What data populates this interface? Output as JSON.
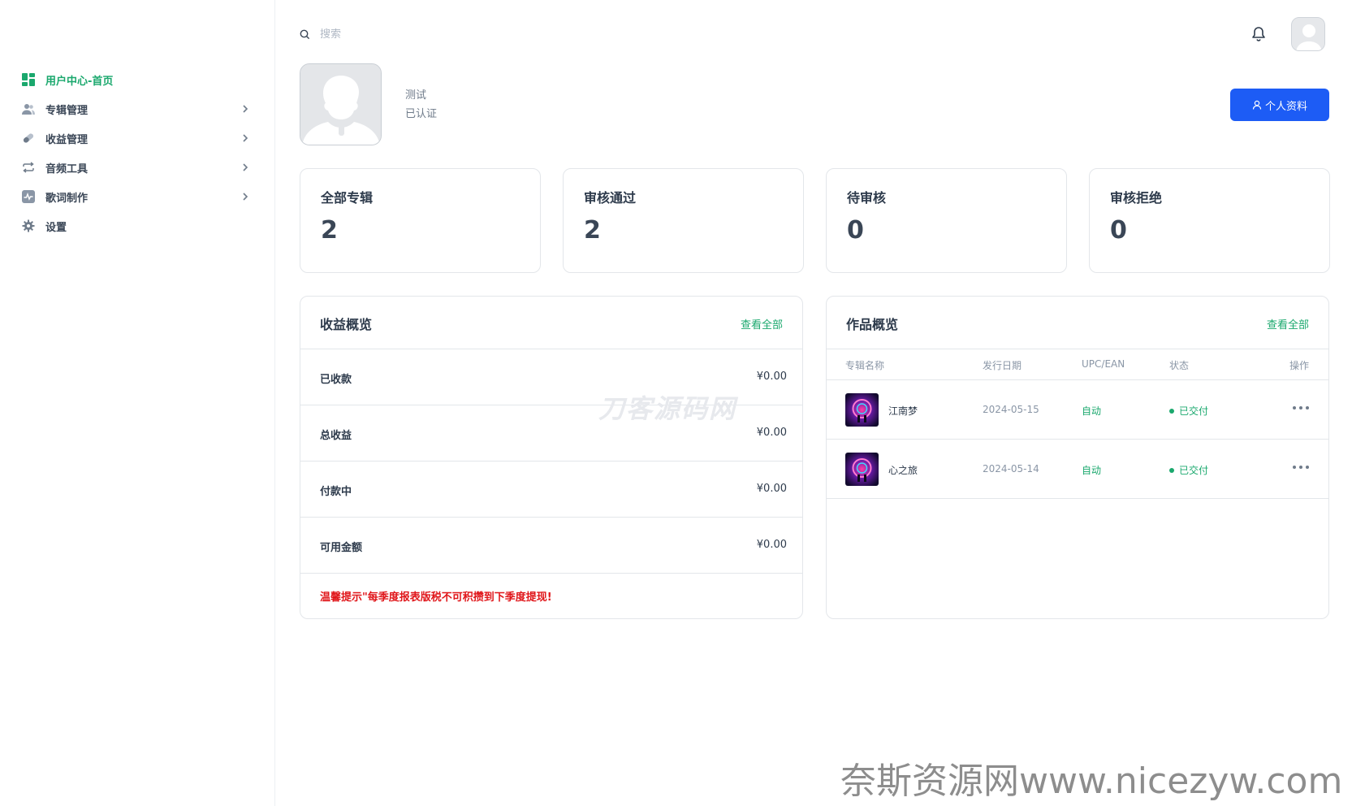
{
  "search": {
    "placeholder": "搜索"
  },
  "sidebar": {
    "items": [
      {
        "label": "用户中心-首页",
        "icon": "dashboard-icon",
        "active": true,
        "has_submenu": false
      },
      {
        "label": "专辑管理",
        "icon": "users-icon",
        "active": false,
        "has_submenu": true
      },
      {
        "label": "收益管理",
        "icon": "pill-icon",
        "active": false,
        "has_submenu": true
      },
      {
        "label": "音频工具",
        "icon": "repeat-icon",
        "active": false,
        "has_submenu": true
      },
      {
        "label": "歌词制作",
        "icon": "activity-icon",
        "active": false,
        "has_submenu": true
      },
      {
        "label": "设置",
        "icon": "gear-icon",
        "active": false,
        "has_submenu": false
      }
    ]
  },
  "profile": {
    "name": "测试",
    "status": "已认证",
    "button_label": "个人资料"
  },
  "stats": [
    {
      "title": "全部专辑",
      "value": "2"
    },
    {
      "title": "审核通过",
      "value": "2"
    },
    {
      "title": "待审核",
      "value": "0"
    },
    {
      "title": "审核拒绝",
      "value": "0"
    }
  ],
  "earnings": {
    "title": "收益概览",
    "link": "查看全部",
    "rows": [
      {
        "label": "已收款",
        "value": "¥0.00"
      },
      {
        "label": "总收益",
        "value": "¥0.00"
      },
      {
        "label": "付款中",
        "value": "¥0.00"
      },
      {
        "label": "可用金额",
        "value": "¥0.00"
      }
    ],
    "tip": "温馨提示\"每季度报表版税不可积攒到下季度提现!"
  },
  "works": {
    "title": "作品概览",
    "link": "查看全部",
    "columns": [
      "专辑名称",
      "发行日期",
      "UPC/EAN",
      "状态",
      "操作"
    ],
    "rows": [
      {
        "name": "江南梦",
        "date": "2024-05-15",
        "upc": "自动",
        "status": "已交付"
      },
      {
        "name": "心之旅",
        "date": "2024-05-14",
        "upc": "自动",
        "status": "已交付"
      }
    ]
  },
  "watermarks": {
    "center": "刀客源码网",
    "corner": "奈斯资源网www.nicezyw.com"
  },
  "colors": {
    "accent_green": "#1aa86d",
    "primary_blue": "#1d5cf5",
    "warning_red": "#e0161a"
  }
}
